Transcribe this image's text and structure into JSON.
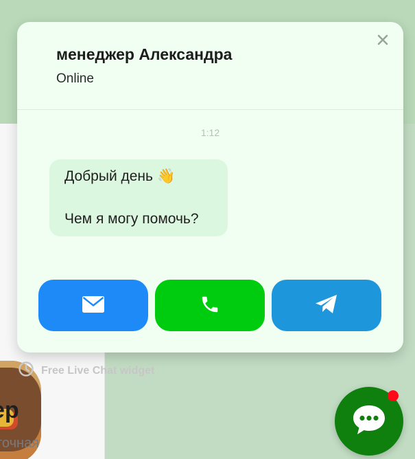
{
  "background": {
    "product_title": "ер",
    "product_subtitle": "точная",
    "watermark_text": "Free Live Chat widget"
  },
  "chat": {
    "manager_name": "менеджер Александра",
    "status": "Online",
    "message_time": "1:12",
    "message_line1": "Добрый день",
    "message_emoji": "👋",
    "message_line2": "Чем я могу помочь?"
  },
  "actions": [
    {
      "name": "email",
      "icon": "envelope-icon",
      "color": "#1d8af7"
    },
    {
      "name": "phone",
      "icon": "phone-icon",
      "color": "#00cc0f"
    },
    {
      "name": "telegram",
      "icon": "telegram-plane-icon",
      "color": "#1e96dc"
    }
  ],
  "launcher": {
    "icon": "chat-bubble-dots-icon",
    "color": "#0f800e",
    "badge_color": "#ff0a16"
  }
}
